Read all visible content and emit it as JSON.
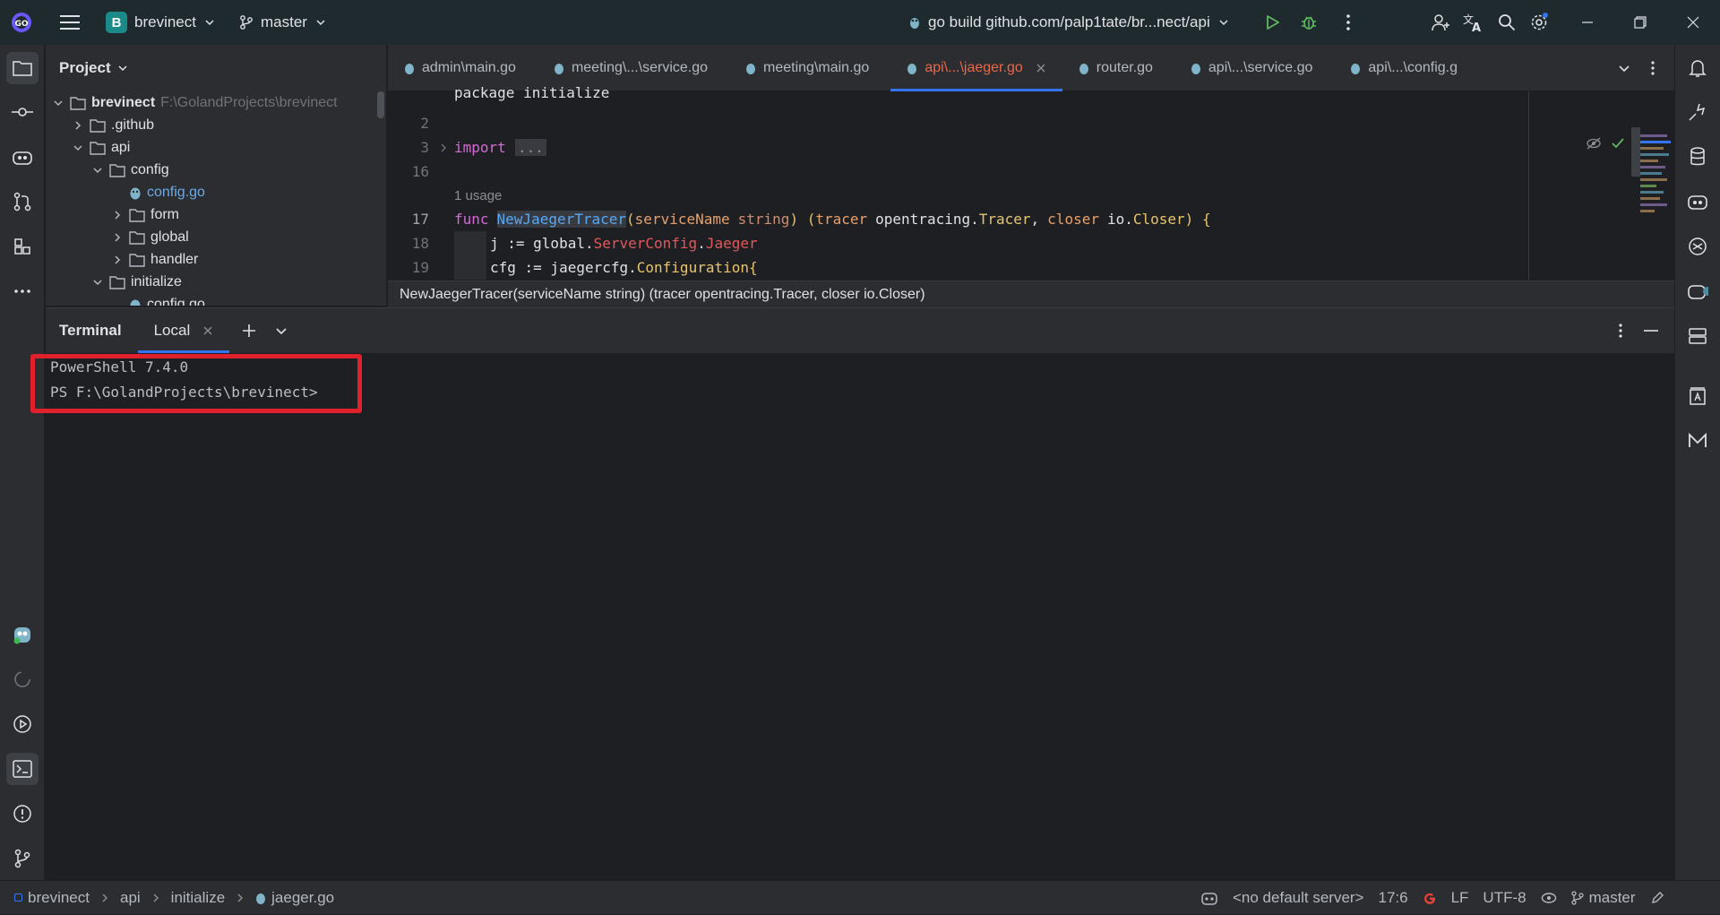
{
  "titlebar": {
    "project_badge": "B",
    "project_name": "brevinect",
    "branch": "master",
    "run_config": "go build github.com/palp1tate/br...nect/api"
  },
  "project_panel": {
    "title": "Project",
    "root_name": "brevinect",
    "root_path": "F:\\GolandProjects\\brevinect",
    "items": [
      {
        "label": ".github"
      },
      {
        "label": "api"
      },
      {
        "label": "config"
      },
      {
        "label": "config.go"
      },
      {
        "label": "form"
      },
      {
        "label": "global"
      },
      {
        "label": "handler"
      },
      {
        "label": "initialize"
      },
      {
        "label": "config.go"
      }
    ]
  },
  "editor": {
    "tabs": [
      {
        "label": "admin\\main.go"
      },
      {
        "label": "meeting\\...\\service.go"
      },
      {
        "label": "meeting\\main.go"
      },
      {
        "label": "api\\...\\jaeger.go"
      },
      {
        "label": "router.go"
      },
      {
        "label": "api\\...\\service.go"
      },
      {
        "label": "api\\...\\config.g"
      }
    ],
    "lines": {
      "l1": "package initialize",
      "l2": "2",
      "l3": "3",
      "import_kw": "import",
      "import_fold": "...",
      "l16": "16",
      "usage": "1 usage",
      "l17": "17",
      "func_kw": "func",
      "func_name": "NewJaegerTracer",
      "paren_open": "(",
      "p1": "serviceName",
      "t1": "string",
      "mid": ") (",
      "p2": "tracer",
      "pkg1": "opentracing.",
      "t2": "Tracer",
      "comma": ",",
      "p3": "closer",
      "pkg2": "io.",
      "t3": "Closer",
      "end17": ") {",
      "l18": "18",
      "code18a": "j := global.",
      "code18b": "ServerConfig",
      "code18c": ".",
      "code18d": "Jaeger",
      "l19": "19",
      "code19a": "cfg := jaegercfg.",
      "code19b": "Configuration",
      "code19c": "{"
    },
    "hint": "NewJaegerTracer(serviceName string) (tracer opentracing.Tracer, closer io.Closer)"
  },
  "terminal": {
    "title": "Terminal",
    "tab_label": "Local",
    "lines": [
      "PowerShell 7.4.0",
      "PS F:\\GolandProjects\\brevinect>"
    ]
  },
  "statusbar": {
    "breadcrumb": [
      "brevinect",
      "api",
      "initialize",
      "jaeger.go"
    ],
    "server": "<no default server>",
    "position": "17:6",
    "line_sep": "LF",
    "encoding": "UTF-8",
    "branch": "master"
  },
  "colors": {
    "accent": "#3574f0",
    "highlight_box": "#e0202a",
    "active_tab_text": "#e8684a"
  }
}
